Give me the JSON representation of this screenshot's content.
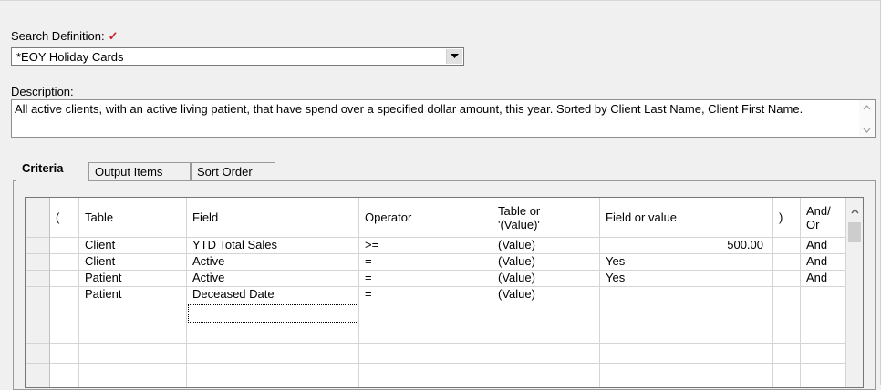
{
  "search_definition": {
    "label": "Search Definition:",
    "required_mark": "✓",
    "value": "*EOY Holiday Cards"
  },
  "description": {
    "label": "Description:",
    "text": "All active clients, with an active living patient, that have spend over a specified dollar amount, this year.  Sorted by Client Last Name, Client First Name."
  },
  "tabs": [
    {
      "label": "Criteria",
      "active": true
    },
    {
      "label": "Output Items",
      "active": false
    },
    {
      "label": "Sort Order",
      "active": false
    }
  ],
  "grid": {
    "headers": {
      "paren_open": "(",
      "table": "Table",
      "field": "Field",
      "operator": "Operator",
      "table_or_value_1": "Table or",
      "table_or_value_2": "'(Value)'",
      "field_or_value": "Field or value",
      "paren_close": ")",
      "and_or_1": "And/",
      "and_or_2": "Or"
    },
    "rows": [
      {
        "paren_open": "",
        "table": "Client",
        "field": "YTD Total Sales",
        "operator": ">=",
        "table_or_value": "(Value)",
        "field_or_value": "500.00",
        "paren_close": "",
        "and_or": "And"
      },
      {
        "paren_open": "",
        "table": "Client",
        "field": "Active",
        "operator": "=",
        "table_or_value": "(Value)",
        "field_or_value": "Yes",
        "paren_close": "",
        "and_or": "And"
      },
      {
        "paren_open": "",
        "table": "Patient",
        "field": "Active",
        "operator": "=",
        "table_or_value": "(Value)",
        "field_or_value": "Yes",
        "paren_close": "",
        "and_or": "And"
      },
      {
        "paren_open": "",
        "table": "Patient",
        "field": "Deceased Date",
        "operator": "=",
        "table_or_value": "(Value)",
        "field_or_value": "",
        "paren_close": "",
        "and_or": ""
      }
    ]
  }
}
